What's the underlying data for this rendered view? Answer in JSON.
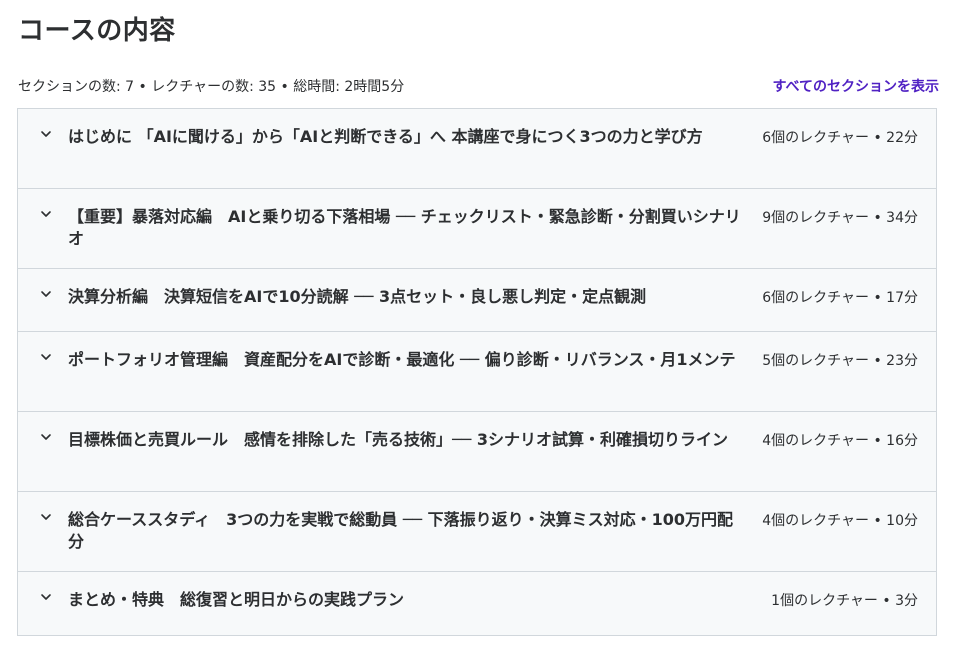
{
  "page": {
    "title": "コースの内容",
    "meta": "セクションの数: 7 • レクチャーの数: 35 • 総時間: 2時間5分",
    "show_all": "すべてのセクションを表示"
  },
  "sections": [
    {
      "title": "はじめに 「AIに聞ける」から「AIと判断できる」へ 本講座で身につく3つの力と学び方",
      "info": "6個のレクチャー • 22分"
    },
    {
      "title": "【重要】暴落対応編　AIと乗り切る下落相場 ── チェックリスト・緊急診断・分割買いシナリオ",
      "info": "9個のレクチャー • 34分"
    },
    {
      "title": "決算分析編　決算短信をAIで10分読解 ── 3点セット・良し悪し判定・定点観測",
      "info": "6個のレクチャー • 17分"
    },
    {
      "title": "ポートフォリオ管理編　資産配分をAIで診断・最適化 ── 偏り診断・リバランス・月1メンテ",
      "info": "5個のレクチャー • 23分"
    },
    {
      "title": "目標株価と売買ルール　感情を排除した「売る技術」── 3シナリオ試算・利確損切りライン",
      "info": "4個のレクチャー • 16分"
    },
    {
      "title": "総合ケーススタディ　3つの力を実戦で総動員 ── 下落振り返り・決算ミス対応・100万円配分",
      "info": "4個のレクチャー • 10分"
    },
    {
      "title": "まとめ・特典　総復習と明日からの実践プラン",
      "info": "1個のレクチャー • 3分"
    }
  ],
  "icons": {
    "expand": "chevron-down-icon"
  },
  "colors": {
    "accent": "#5022c3",
    "section_bg": "#f7f9fa",
    "border": "#d1d7dc",
    "text": "#2d2f31"
  }
}
